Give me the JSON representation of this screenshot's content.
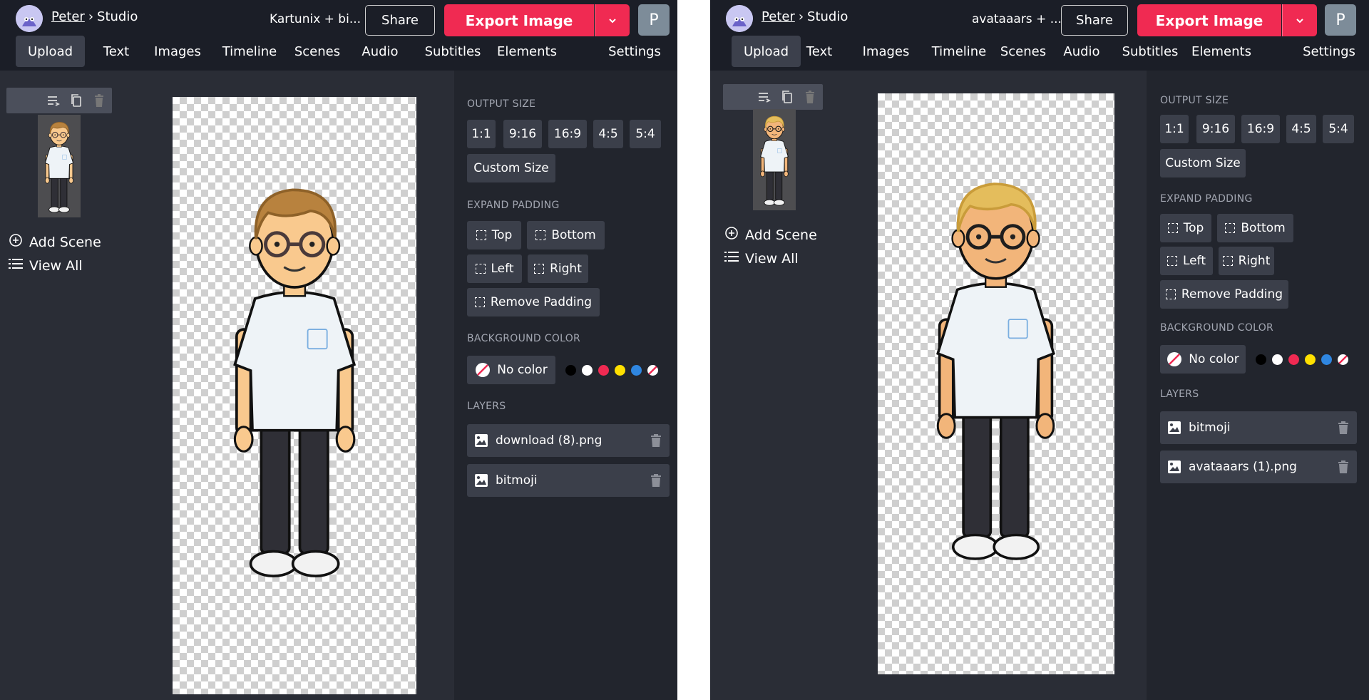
{
  "panels": [
    {
      "breadcrumb": {
        "user": "Peter",
        "separator": "›",
        "section": "Studio"
      },
      "project_title": "Kartunix + bi...",
      "share_label": "Share",
      "export_label": "Export Image",
      "avatar_letter": "P",
      "nav": [
        "Upload",
        "Text",
        "Images",
        "Timeline",
        "Scenes",
        "Audio",
        "Subtitles",
        "Elements",
        "Settings"
      ],
      "active_nav": "Upload",
      "scenes": {
        "add_label": "Add Scene",
        "view_all_label": "View All"
      },
      "output_size": {
        "label": "OUTPUT SIZE",
        "ratios": [
          "1:1",
          "9:16",
          "16:9",
          "4:5",
          "5:4"
        ],
        "custom_label": "Custom Size"
      },
      "padding": {
        "label": "EXPAND PADDING",
        "top": "Top",
        "bottom": "Bottom",
        "left": "Left",
        "right": "Right",
        "remove": "Remove Padding"
      },
      "background": {
        "label": "BACKGROUND COLOR",
        "no_color_label": "No color",
        "swatches": [
          "#000000",
          "#ffffff",
          "#f02a52",
          "#ffe000",
          "#2f86e0",
          "none"
        ]
      },
      "layers": {
        "label": "LAYERS",
        "items": [
          "download (8).png",
          "bitmoji"
        ]
      },
      "character": {
        "hair": "#b8823e",
        "hair_dark": "#8e6128",
        "skin": "#f9c98e",
        "glasses": "#4a3a3a"
      }
    },
    {
      "breadcrumb": {
        "user": "Peter",
        "separator": "›",
        "section": "Studio"
      },
      "project_title": "avataaars + ...",
      "share_label": "Share",
      "export_label": "Export Image",
      "avatar_letter": "P",
      "nav": [
        "Upload",
        "Text",
        "Images",
        "Timeline",
        "Scenes",
        "Audio",
        "Subtitles",
        "Elements",
        "Settings"
      ],
      "active_nav": "Upload",
      "scenes": {
        "add_label": "Add Scene",
        "view_all_label": "View All"
      },
      "output_size": {
        "label": "OUTPUT SIZE",
        "ratios": [
          "1:1",
          "9:16",
          "16:9",
          "4:5",
          "5:4"
        ],
        "custom_label": "Custom Size"
      },
      "padding": {
        "label": "EXPAND PADDING",
        "top": "Top",
        "bottom": "Bottom",
        "left": "Left",
        "right": "Right",
        "remove": "Remove Padding"
      },
      "background": {
        "label": "BACKGROUND COLOR",
        "no_color_label": "No color",
        "swatches": [
          "#000000",
          "#ffffff",
          "#f02a52",
          "#ffe000",
          "#2f86e0",
          "none"
        ]
      },
      "layers": {
        "label": "LAYERS",
        "items": [
          "bitmoji",
          "avataaars (1).png"
        ]
      },
      "character": {
        "hair": "#e4bd5c",
        "hair_dark": "#c99c3a",
        "skin": "#f2b57a",
        "glasses": "#1e1e1e"
      }
    }
  ]
}
